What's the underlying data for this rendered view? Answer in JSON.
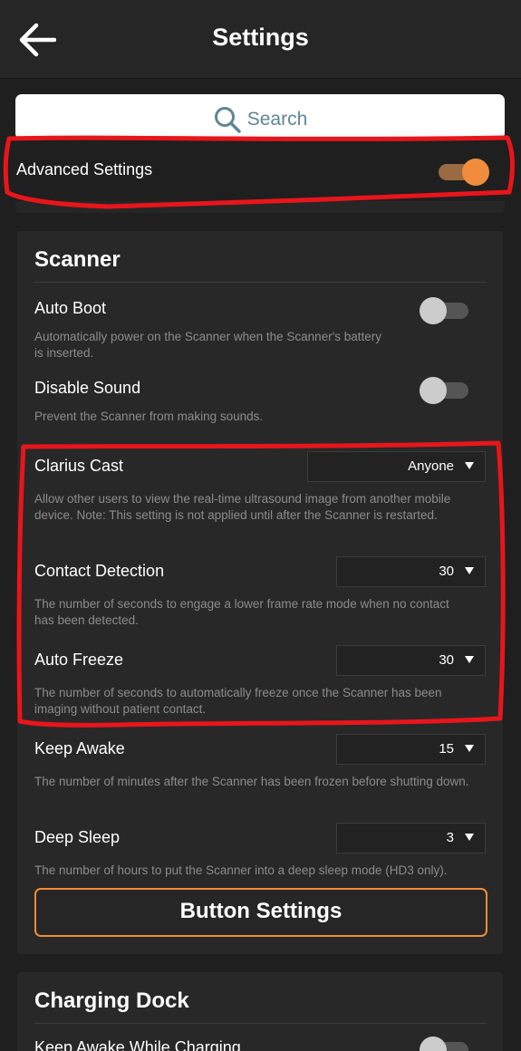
{
  "header": {
    "title": "Settings"
  },
  "search": {
    "placeholder": "Search"
  },
  "advanced": {
    "label": "Advanced Settings",
    "enabled": true
  },
  "scanner": {
    "title": "Scanner",
    "auto_boot": {
      "label": "Auto Boot",
      "desc": "Automatically power on the Scanner when the Scanner's battery is inserted.",
      "enabled": false
    },
    "disable_sound": {
      "label": "Disable Sound",
      "desc": "Prevent the Scanner from making sounds.",
      "enabled": false
    },
    "clarius_cast": {
      "label": "Clarius Cast",
      "value": "Anyone",
      "desc": "Allow other users to view the real-time ultrasound image from another mobile device. Note: This setting is not applied until after the Scanner is restarted."
    },
    "contact_detection": {
      "label": "Contact Detection",
      "value": "30",
      "desc": "The number of seconds to engage a lower frame rate mode when no contact has been detected."
    },
    "auto_freeze": {
      "label": "Auto Freeze",
      "value": "30",
      "desc": "The number of seconds to automatically freeze once the Scanner has been imaging without patient contact."
    },
    "keep_awake": {
      "label": "Keep Awake",
      "value": "15",
      "desc": "The number of minutes after the Scanner has been frozen before shutting down."
    },
    "deep_sleep": {
      "label": "Deep Sleep",
      "value": "3",
      "desc": "The number of hours to put the Scanner into a deep sleep mode (HD3 only)."
    },
    "button_settings": "Button Settings"
  },
  "charging_dock": {
    "title": "Charging Dock",
    "keep_awake_while_charging": {
      "label": "Keep Awake While Charging",
      "enabled": false
    }
  },
  "colors": {
    "accent": "#f08c3b",
    "annotation": "#e8151b"
  }
}
